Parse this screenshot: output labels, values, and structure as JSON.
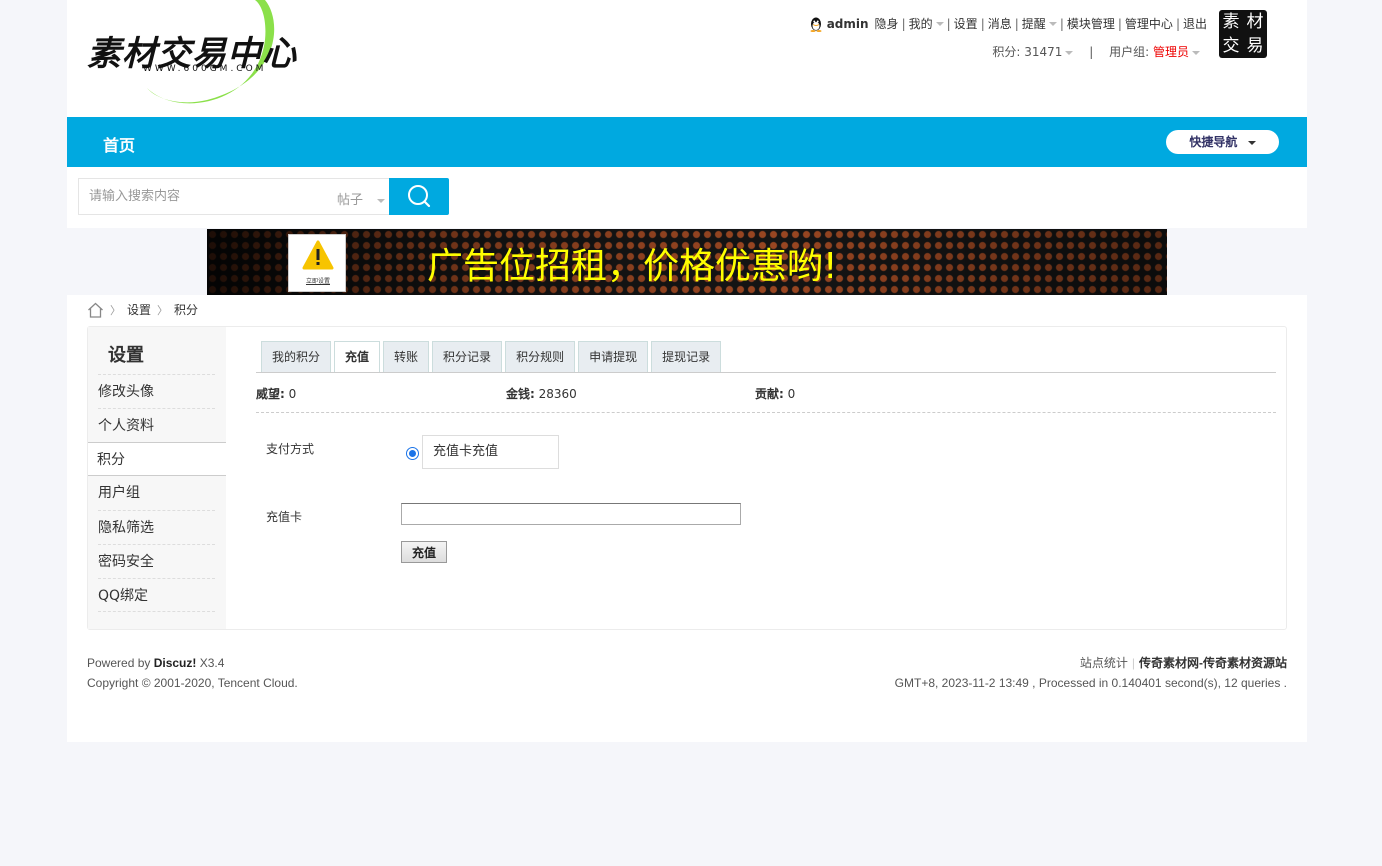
{
  "header": {
    "logo_text": "素材交易中心",
    "logo_url": "WWW.600GM.COM",
    "user": "admin",
    "links": [
      "隐身",
      "我的",
      "设置",
      "消息",
      "提醒",
      "模块管理",
      "管理中心",
      "退出"
    ],
    "credits_label": "积分: 31471",
    "group_label": "用户组:",
    "group_value": "管理员",
    "mini_logo": [
      "素",
      "材",
      "交",
      "易"
    ]
  },
  "nav": {
    "home": "首页",
    "quick_nav": "快捷导航"
  },
  "search": {
    "placeholder": "请输入搜索内容",
    "type": "帖子"
  },
  "banner": {
    "text": "广告位招租，价格优惠哟!",
    "warn_label": "立即设置"
  },
  "breadcrumb": [
    "设置",
    "积分"
  ],
  "sidebar": {
    "title": "设置",
    "items": [
      "修改头像",
      "个人资料",
      "积分",
      "用户组",
      "隐私筛选",
      "密码安全",
      "QQ绑定"
    ]
  },
  "tabs": [
    "我的积分",
    "充值",
    "转账",
    "积分记录",
    "积分规则",
    "申请提现",
    "提现记录"
  ],
  "stats": [
    {
      "label": "威望:",
      "value": "0"
    },
    {
      "label": "金钱:",
      "value": "28360"
    },
    {
      "label": "贡献:",
      "value": "0"
    }
  ],
  "form": {
    "pay_label": "支付方式",
    "pay_option": "充值卡充值",
    "card_label": "充值卡",
    "card_value": "",
    "submit": "充值"
  },
  "footer": {
    "powered_prefix": "Powered by ",
    "powered_brand": "Discuz!",
    "powered_version": " X3.4",
    "copyright": "Copyright © 2001-2020, Tencent Cloud.",
    "stats_link": "站点统计",
    "site_name": "传奇素材网-传奇素材资源站",
    "process_info": "GMT+8, 2023-11-2 13:49 , Processed in 0.140401 second(s), 12 queries ."
  },
  "colors": {
    "nav_blue": "#00a9e0",
    "group_red": "#ee0000",
    "banner_yellow": "#ffff00"
  }
}
